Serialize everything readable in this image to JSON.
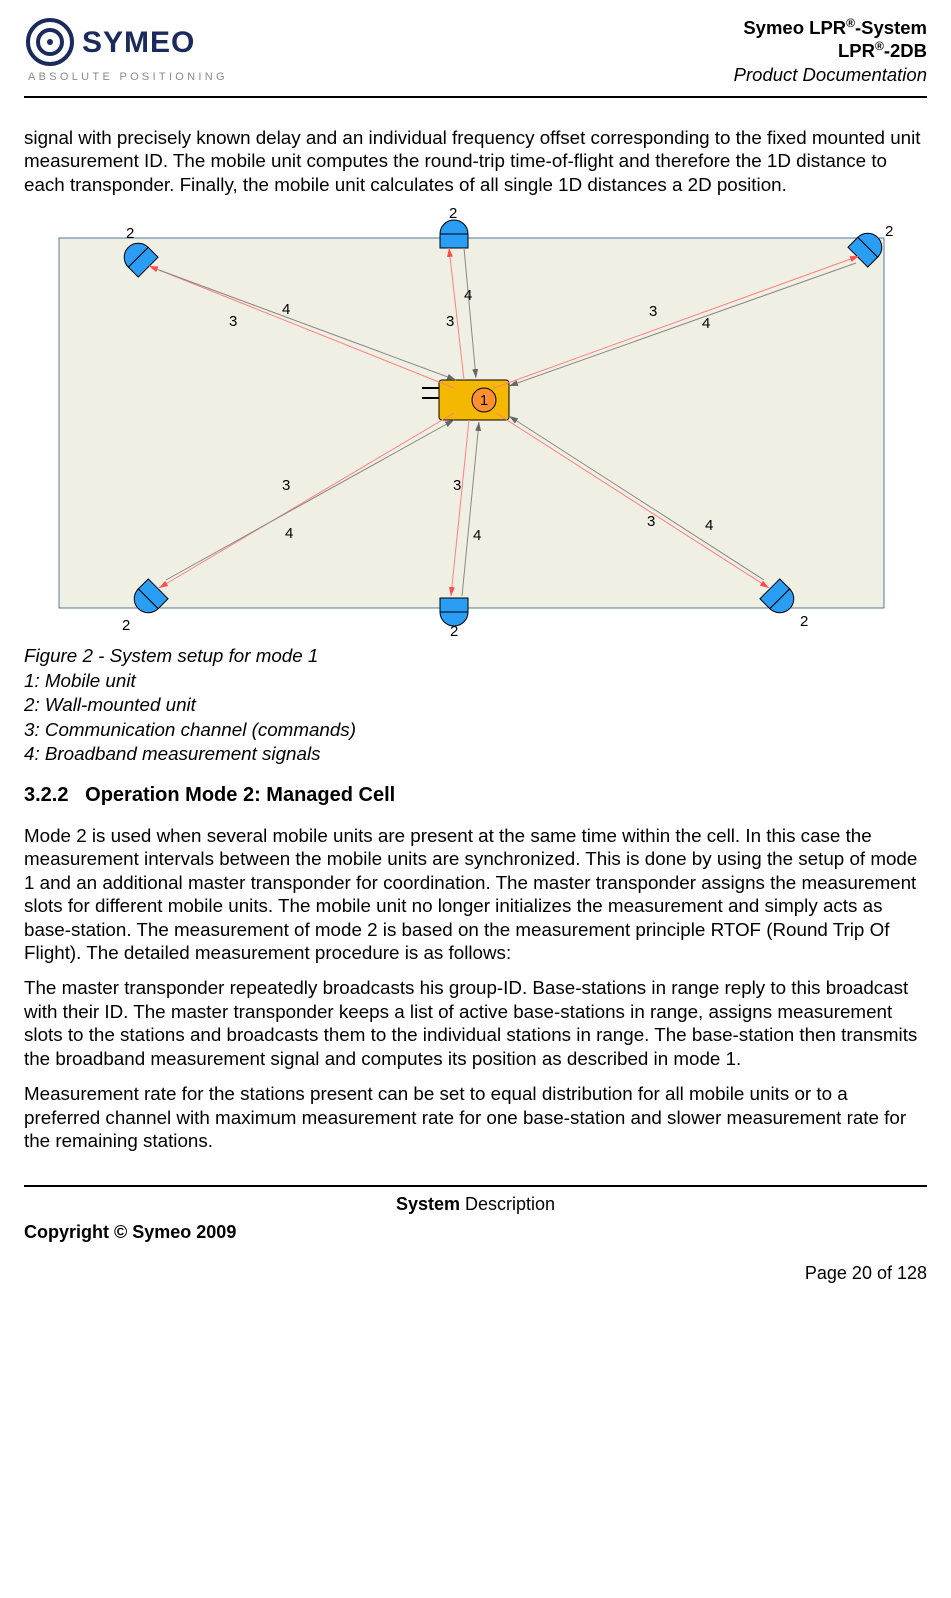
{
  "header": {
    "logo_text_main": "SYMEO",
    "logo_text_sub": "ABSOLUTE POSITIONING",
    "title_line1_pre": "Symeo LPR",
    "title_line1_post": "-System",
    "title_line2_pre": "LPR",
    "title_line2_post": "-2DB",
    "subtitle": "Product Documentation",
    "reg": "®"
  },
  "para1": "signal with precisely known delay and an individual frequency offset corresponding to the fixed mounted unit measurement ID. The mobile unit computes the round-trip time-of-flight and therefore the 1D distance to each transponder. Finally, the mobile unit calculates of all single 1D distances a 2D position.",
  "figure": {
    "label_1": "1",
    "label_2": "2",
    "label_3": "3",
    "label_4": "4",
    "caption_title": "Figure 2 - System setup for mode 1",
    "caption_l1": "1: Mobile unit",
    "caption_l2": "2: Wall-mounted unit",
    "caption_l3": "3: Communication channel (commands)",
    "caption_l4": "4: Broadband measurement signals"
  },
  "chart_data": {
    "type": "diagram",
    "title": "System setup for mode 1",
    "nodes": [
      {
        "id": 1,
        "role": "Mobile unit",
        "position": "center"
      },
      {
        "id": 2,
        "role": "Wall-mounted unit",
        "count": 6,
        "positions": [
          "top-left",
          "top-center",
          "top-right",
          "bottom-left",
          "bottom-center",
          "bottom-right"
        ]
      }
    ],
    "edge_legend": {
      "3": "Communication channel (commands)",
      "4": "Broadband measurement signals"
    },
    "edges_per_wall_unit": [
      "3",
      "4"
    ]
  },
  "section": {
    "number": "3.2.2",
    "title": "Operation Mode 2: Managed Cell"
  },
  "para2": "Mode 2 is used when several mobile units are present at the same time within the cell. In this case the measurement intervals between the mobile units are synchronized. This is done by using the setup of mode 1 and an additional master transponder for coordination. The master transponder assigns the measurement slots for different mobile units. The mobile unit no longer initializes the measurement and simply acts as base-station. The measurement of mode 2 is based on the measurement principle RTOF (Round Trip Of Flight). The detailed measurement procedure is as follows:",
  "para3": "The master transponder repeatedly broadcasts his group-ID. Base-stations in range reply to this broadcast with their ID. The master transponder keeps a list of active base-stations in range, assigns measurement slots to the stations and broadcasts them to the individual stations in range. The base-station then transmits the broadband measurement signal and computes its position as described in mode 1.",
  "para4": "Measurement rate for the stations present can be set to equal distribution for all mobile units or to a preferred channel with maximum measurement rate for one base-station and slower measurement rate for the remaining stations.",
  "footer": {
    "center_bold": "System",
    "center_rest": " Description",
    "copyright": "Copyright © Symeo 2009",
    "page": "Page 20 of 128"
  }
}
